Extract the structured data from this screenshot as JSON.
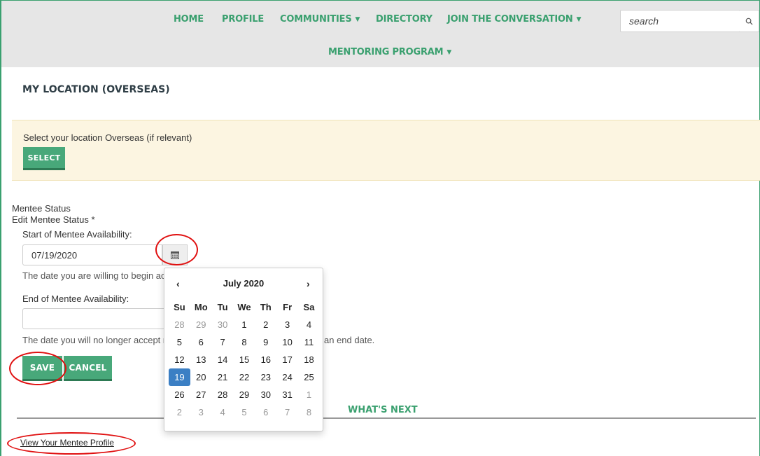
{
  "nav": {
    "home": "HOME",
    "profile": "PROFILE",
    "communities": "COMMUNITIES",
    "directory": "DIRECTORY",
    "join": "JOIN THE CONVERSATION",
    "mentoring": "MENTORING PROGRAM",
    "search_placeholder": "search"
  },
  "page": {
    "title": "MY LOCATION (OVERSEAS)",
    "notice_text": "Select your location Overseas (if relevant)",
    "select_label": "SELECT",
    "mentee_status": "Mentee Status",
    "edit_status": "Edit Mentee Status *",
    "start_label": "Start of Mentee Availability:",
    "start_value": "07/19/2020",
    "start_help": "The date you are willing to begin ac",
    "end_label": "End of Mentee Availability:",
    "end_value": "",
    "end_help_left": "The date you will no longer accept n",
    "end_help_right": "an end date.",
    "save_label": "SAVE",
    "cancel_label": "CANCEL",
    "whats_next": "WHAT'S NEXT",
    "profile_link": "View Your Mentee Profile"
  },
  "calendar": {
    "month": "July 2020",
    "prev": "‹",
    "next": "›",
    "dow": [
      "Su",
      "Mo",
      "Tu",
      "We",
      "Th",
      "Fr",
      "Sa"
    ],
    "weeks": [
      [
        {
          "d": "28",
          "m": true
        },
        {
          "d": "29",
          "m": true
        },
        {
          "d": "30",
          "m": true
        },
        {
          "d": "1"
        },
        {
          "d": "2"
        },
        {
          "d": "3"
        },
        {
          "d": "4"
        }
      ],
      [
        {
          "d": "5"
        },
        {
          "d": "6"
        },
        {
          "d": "7"
        },
        {
          "d": "8"
        },
        {
          "d": "9"
        },
        {
          "d": "10"
        },
        {
          "d": "11"
        }
      ],
      [
        {
          "d": "12"
        },
        {
          "d": "13"
        },
        {
          "d": "14"
        },
        {
          "d": "15"
        },
        {
          "d": "16"
        },
        {
          "d": "17"
        },
        {
          "d": "18"
        }
      ],
      [
        {
          "d": "19",
          "s": true
        },
        {
          "d": "20"
        },
        {
          "d": "21"
        },
        {
          "d": "22"
        },
        {
          "d": "23"
        },
        {
          "d": "24"
        },
        {
          "d": "25"
        }
      ],
      [
        {
          "d": "26"
        },
        {
          "d": "27"
        },
        {
          "d": "28"
        },
        {
          "d": "29"
        },
        {
          "d": "30"
        },
        {
          "d": "31"
        },
        {
          "d": "1",
          "m": true
        }
      ],
      [
        {
          "d": "2",
          "m": true
        },
        {
          "d": "3",
          "m": true
        },
        {
          "d": "4",
          "m": true
        },
        {
          "d": "5",
          "m": true
        },
        {
          "d": "6",
          "m": true
        },
        {
          "d": "7",
          "m": true
        },
        {
          "d": "8",
          "m": true
        }
      ]
    ]
  },
  "colors": {
    "accent": "#3aa06f",
    "button": "#48a87a",
    "notice_bg": "#fcf5e1",
    "selected_day": "#3b7fc4",
    "annotation": "#e01010"
  },
  "icons": {
    "search": "search-icon",
    "calendar": "calendar-icon"
  }
}
